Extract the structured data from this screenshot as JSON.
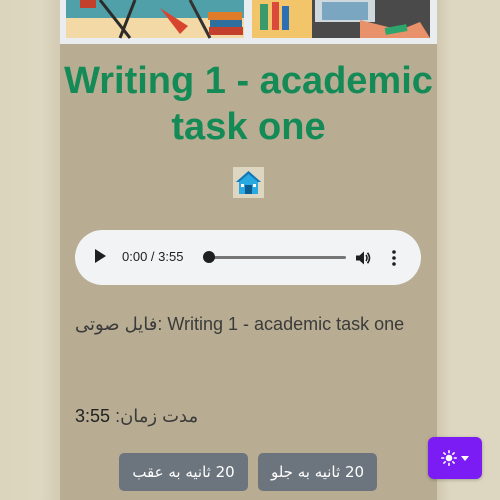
{
  "page": {
    "title": "Writing 1 - academic task one",
    "home_icon": "home-icon"
  },
  "player": {
    "time_display": "0:00 / 3:55",
    "progress": 0,
    "icons": [
      "play-icon",
      "volume-icon",
      "more-options-icon"
    ]
  },
  "audio_info": {
    "file_label": "فایل صوتی:",
    "file_name": "Writing 1 - academic task one",
    "duration_label": "مدت زمان:",
    "duration_value": "3:55"
  },
  "controls": {
    "forward_label": "20 ثانیه به جلو",
    "backward_label": "20 ثانیه به عقب"
  },
  "theme_toggle": {
    "icon": "sun-icon",
    "accent": "#7c1cf5"
  },
  "colors": {
    "title": "#148a57",
    "card_background": "#b8ad92",
    "page_background": "#ddd6c0",
    "button": "#6c757d"
  }
}
